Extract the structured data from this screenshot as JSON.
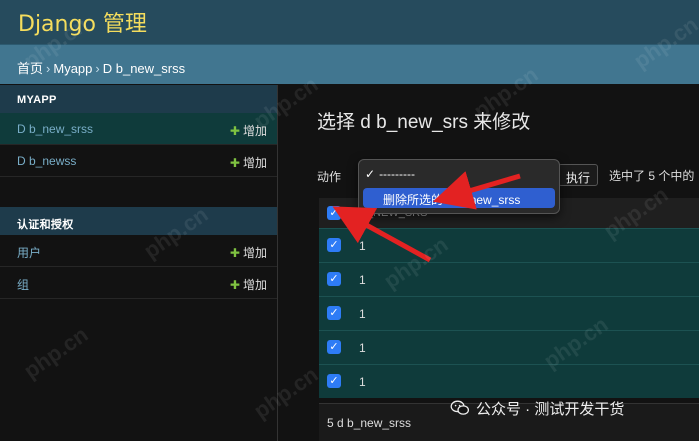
{
  "header": {
    "brand": "Django 管理"
  },
  "breadcrumbs": [
    "首页",
    "Myapp",
    "D b_new_srss"
  ],
  "breadcrumb_sep": "›",
  "sidebar": {
    "modules": [
      {
        "caption": "MYAPP",
        "items": [
          {
            "label": "D b_new_srss",
            "add": "增加",
            "active": true
          },
          {
            "label": "D b_newss",
            "add": "增加",
            "active": false
          }
        ]
      },
      {
        "caption": "认证和授权",
        "items": [
          {
            "label": "用户",
            "add": "增加",
            "active": false
          },
          {
            "label": "组",
            "add": "增加",
            "active": false
          }
        ]
      }
    ]
  },
  "main": {
    "title": "选择 d b_new_srs 来修改",
    "action_label": "动作",
    "go_button": "执行",
    "counter": "选中了 5 个中的",
    "dropdown": {
      "placeholder": "---------",
      "selected_option": "删除所选的 d b_new_srss"
    },
    "table": {
      "header": "D_NEW_SRS",
      "rows": [
        "1",
        "1",
        "1",
        "1",
        "1"
      ]
    },
    "paginator": "5 d b_new_srss"
  },
  "watermark": "php.cn",
  "wechat": {
    "text": "公众号 · 测试开发干货"
  },
  "colors": {
    "header_bg": "#264b5d",
    "brand": "#f5dd5d",
    "breadcrumbs_bg": "#417690",
    "selected_row": "#0f3b3b",
    "link": "#79aec8",
    "add_plus": "#7fc241",
    "checkbox": "#2e7cf6",
    "arrow": "#e32222"
  }
}
